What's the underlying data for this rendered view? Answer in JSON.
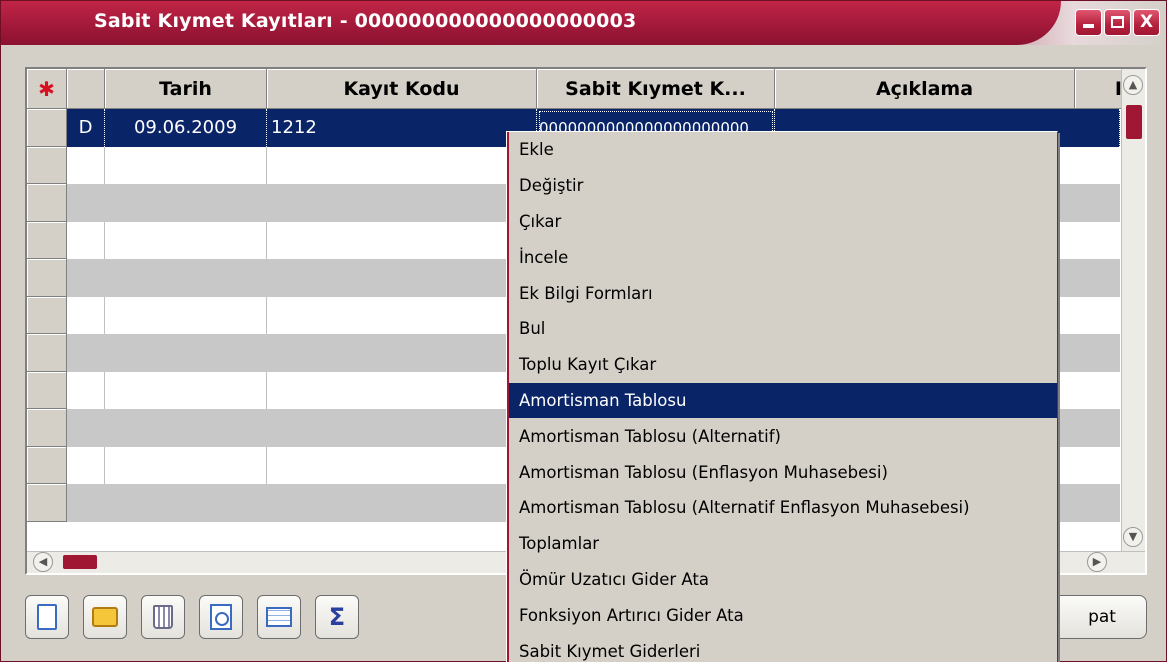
{
  "window": {
    "title": "Sabit Kıymet Kayıtları - 000000000000000000003",
    "minimize": "",
    "maximize": "",
    "close": "X"
  },
  "grid": {
    "columns": [
      "Tarih",
      "Kayıt Kodu",
      "Sabit Kıymet K...",
      "Açıklama",
      "I"
    ],
    "rows": [
      {
        "indicator": "D",
        "date": "09.06.2009",
        "code": "1212",
        "asset": "0000000000000000000000",
        "desc": ""
      }
    ]
  },
  "context_menu": {
    "items": [
      "Ekle",
      "Değiştir",
      "Çıkar",
      "İncele",
      "Ek Bilgi Formları",
      "Bul",
      "Toplu Kayıt Çıkar",
      "Amortisman Tablosu",
      "Amortisman Tablosu (Alternatif)",
      "Amortisman Tablosu (Enflasyon Muhasebesi)",
      "Amortisman Tablosu (Alternatif Enflasyon Muhasebesi)",
      "Toplamlar",
      "Ömür Uzatıcı Gider Ata",
      "Fonksiyon Artırıcı Gider Ata",
      "Sabit Kıymet Giderleri"
    ],
    "active_index": 7
  },
  "toolbar": {
    "sum_label": "Σ",
    "close_button": "pat"
  },
  "colors": {
    "accent": "#a01733",
    "selection": "#0a2468"
  }
}
